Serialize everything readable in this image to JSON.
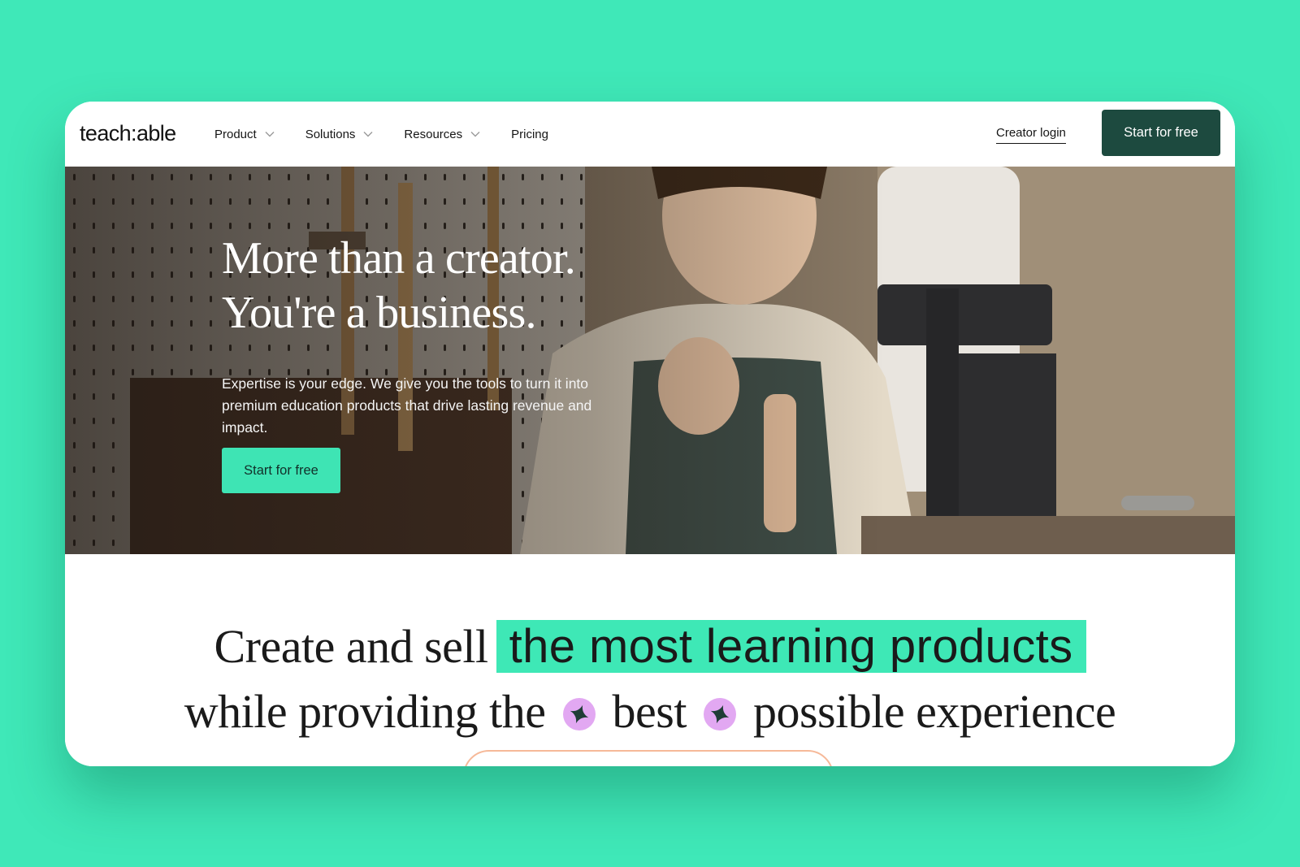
{
  "nav": {
    "logo": "teach:able",
    "menu": [
      {
        "label": "Product",
        "has_dropdown": true
      },
      {
        "label": "Solutions",
        "has_dropdown": true
      },
      {
        "label": "Resources",
        "has_dropdown": true
      },
      {
        "label": "Pricing",
        "has_dropdown": false
      }
    ],
    "login_label": "Creator login",
    "cta_label": "Start for free"
  },
  "hero": {
    "title_line1": "More than a creator.",
    "title_line2": "You're a business.",
    "subtitle": "Expertise is your edge. We give you the tools to turn it into premium education products that drive lasting revenue and impact.",
    "cta_label": "Start for free"
  },
  "tagline": {
    "prefix": "Create and sell",
    "highlight": "the most learning products",
    "line2_a": "while providing the",
    "line2_b": "best",
    "line2_c": "possible experience"
  },
  "colors": {
    "page_bg": "#3fe8b8",
    "brand_dark": "#1d4a3f",
    "accent_green": "#3ee4b4",
    "spark_bg": "#e2a8f2",
    "peek_border": "#f6b999"
  },
  "icons": {
    "dropdown": "chevron-down-icon",
    "sparkle": "sparkle-icon"
  }
}
